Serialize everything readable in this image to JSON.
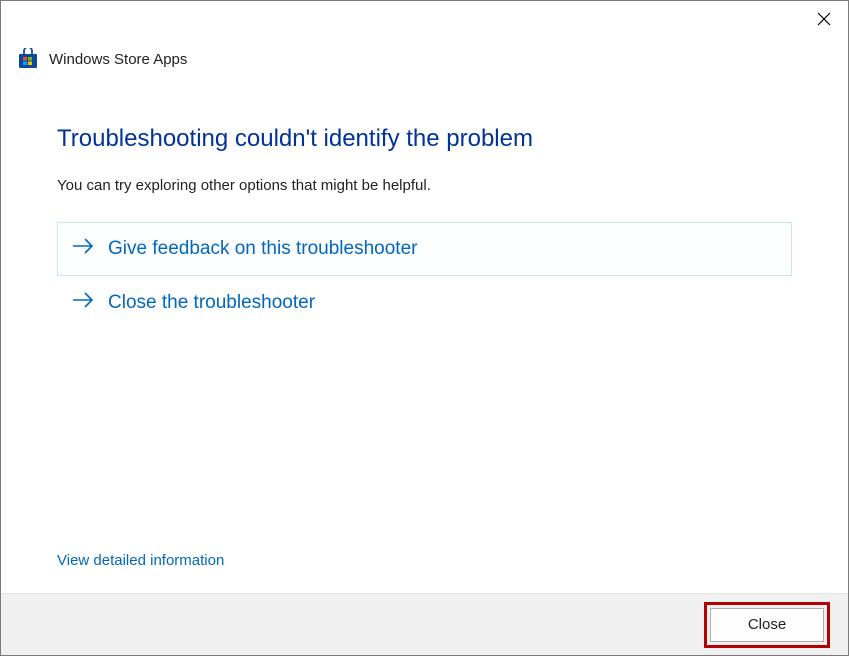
{
  "titlebar": {
    "app_name": "Windows Store Apps"
  },
  "content": {
    "heading": "Troubleshooting couldn't identify the problem",
    "subtext": "You can try exploring other options that might be helpful.",
    "options": [
      {
        "label": "Give feedback on this troubleshooter"
      },
      {
        "label": "Close the troubleshooter"
      }
    ],
    "detail_link": "View detailed information"
  },
  "footer": {
    "close_label": "Close"
  }
}
